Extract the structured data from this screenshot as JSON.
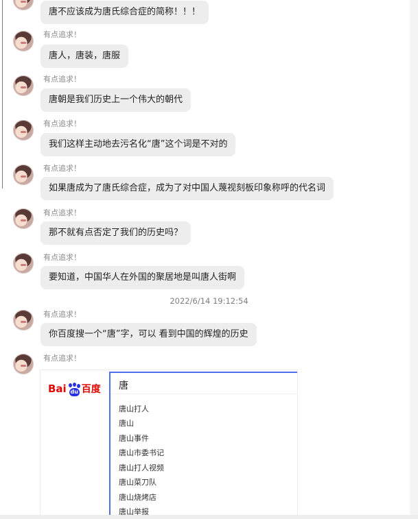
{
  "chat": {
    "sender_name": "有点追求！",
    "first_message": "唐不应该成为唐氏综合症的简称！！！",
    "messages": [
      {
        "sender": "有点追求！",
        "text": "唐人，唐装，唐服"
      },
      {
        "sender": "有点追求！",
        "text": "唐朝是我们历史上一个伟大的朝代"
      },
      {
        "sender": "有点追求！",
        "text": "我们这样主动地去污名化“唐”这个词是不对的"
      },
      {
        "sender": "有点追求！",
        "text": "如果唐成为了唐氏综合症，成为了对中国人蔑视刻板印象称呼的代名词"
      },
      {
        "sender": "有点追求！",
        "text": "那不就有点否定了我们的历史吗？"
      },
      {
        "sender": "有点追求！",
        "text": "要知道，中国华人在外国的聚居地是叫唐人街啊"
      },
      {
        "sender": "有点追求！",
        "text": "你百度搜一个“唐”字，可以 看到中国的辉煌的历史"
      },
      {
        "sender": "有点追求！",
        "text": ""
      }
    ],
    "timestamp": "2022/6/14 19:12:54"
  },
  "baidu_card": {
    "logo_prefix": "Bai",
    "logo_du": "du",
    "logo_cn": "百度",
    "query": "唐",
    "suggestions": [
      "唐山打人",
      "唐山",
      "唐山事件",
      "唐山市委书记",
      "唐山打人视频",
      "唐山菜刀队",
      "唐山烧烤店",
      "唐山举报"
    ]
  },
  "colors": {
    "bubble_bg": "#ededed",
    "baidu_red": "#e10601",
    "baidu_blue": "#2932e1",
    "search_border": "#4e6ef2"
  }
}
